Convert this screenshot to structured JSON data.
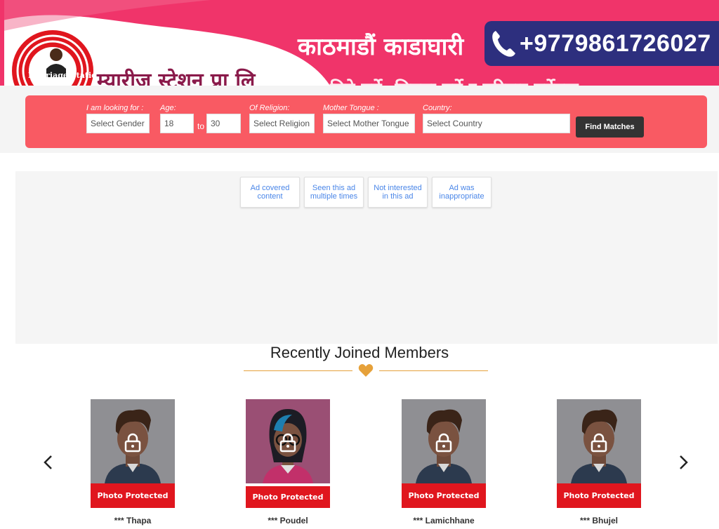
{
  "banner": {
    "logo_text": "Marriage Station",
    "logo_sub": "PVT LTD",
    "headline": "काठमाडौं काडाघारी",
    "phone": "+9779861726027",
    "company_name": "म्यारीज स्टेशन प्रा लि",
    "tagline": "बिहे गर्ने, मित्रता गर्ने र परिवार गर्नेहरू",
    "colors": {
      "pink": "#f0346a",
      "navy": "#2d2f7e",
      "maroon": "#8a1a4a"
    }
  },
  "search": {
    "gender": {
      "label": "I am looking for :",
      "value": "Select Gender"
    },
    "age": {
      "label": "Age:",
      "from": "18",
      "to_label": "to",
      "to": "30"
    },
    "religion": {
      "label": "Of Religion:",
      "value": "Select Religion"
    },
    "tongue": {
      "label": "Mother Tongue :",
      "value": "Select Mother Tongue"
    },
    "country": {
      "label": "Country:",
      "value": "Select Country"
    },
    "button": "Find Matches",
    "colors": {
      "panel": "#f95a63",
      "button": "#333333"
    }
  },
  "ad_feedback": [
    {
      "label": "Ad covered content"
    },
    {
      "label": "Seen this ad multiple times"
    },
    {
      "label": "Not interested in this ad"
    },
    {
      "label": "Ad was inappropriate"
    }
  ],
  "members": {
    "title": "Recently Joined Members",
    "protected_label": "Photo Protected",
    "items": [
      {
        "name": "*** Thapa",
        "gender": "male"
      },
      {
        "name": "*** Poudel",
        "gender": "female"
      },
      {
        "name": "*** Lamichhane",
        "gender": "male"
      },
      {
        "name": "*** Bhujel",
        "gender": "male"
      }
    ],
    "prev_icon": "chevron-left-icon",
    "next_icon": "chevron-right-icon",
    "accent": "#e6a13a"
  }
}
